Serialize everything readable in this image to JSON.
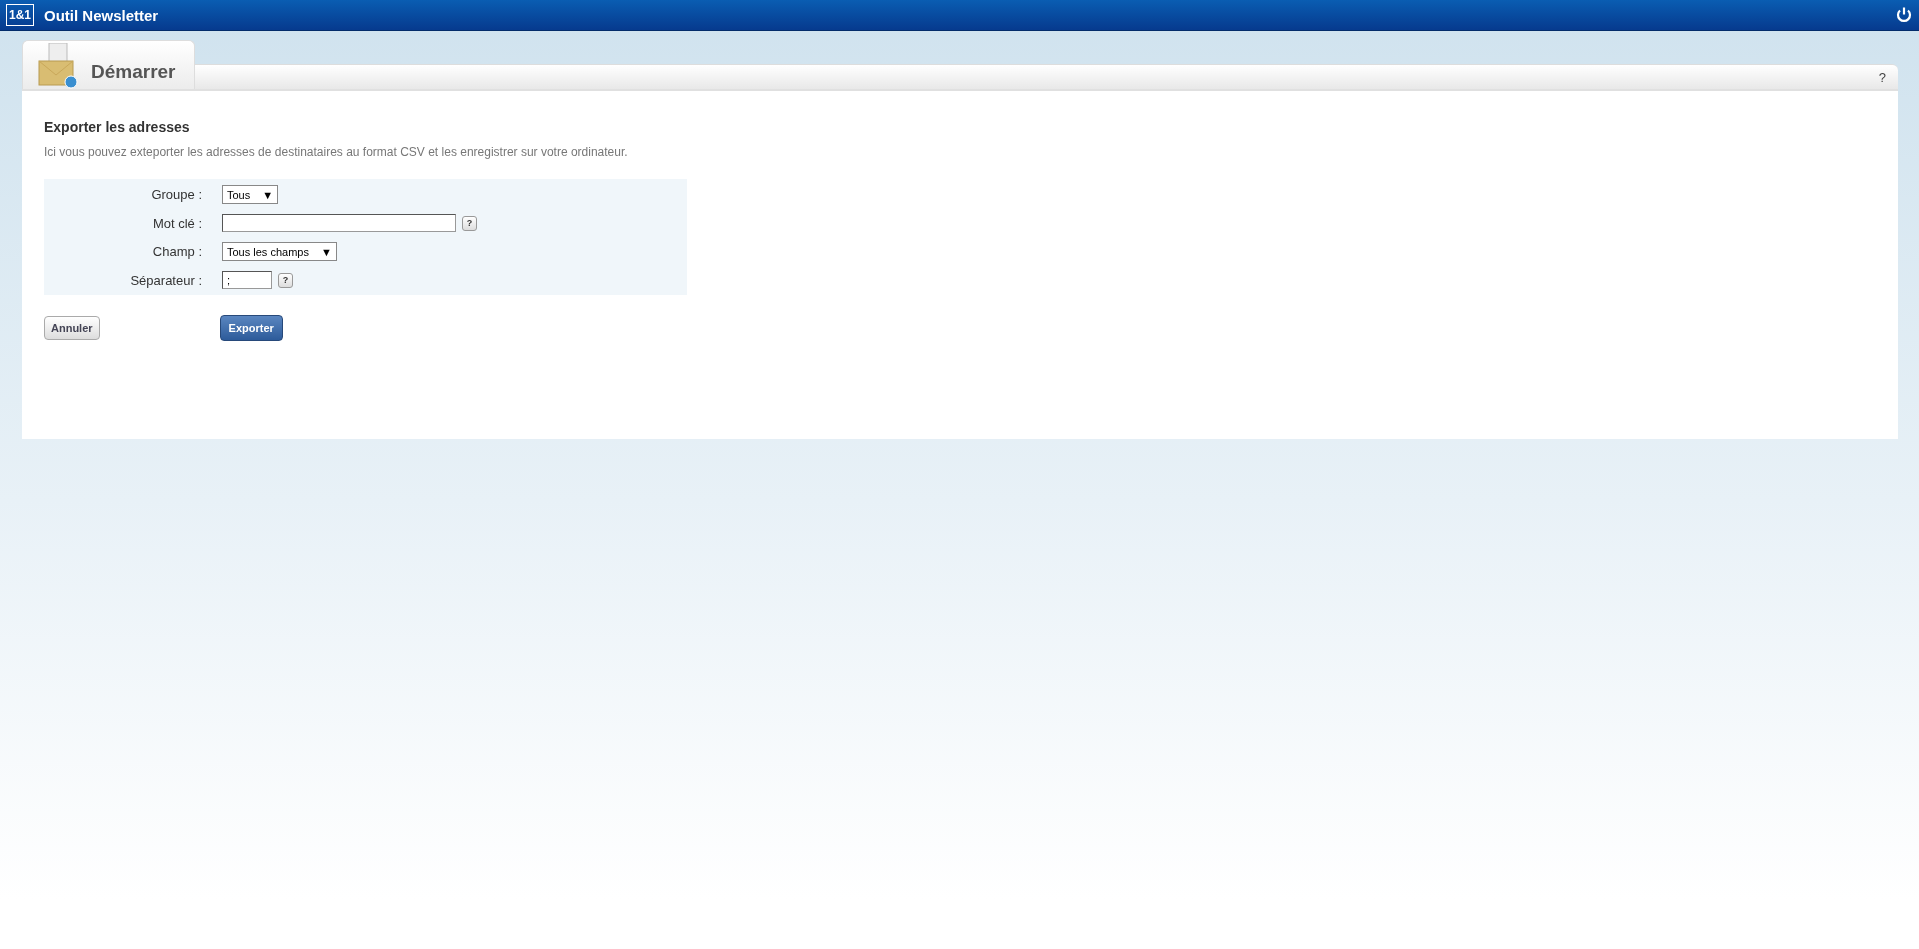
{
  "header": {
    "logo": "1&1",
    "title": "Outil Newsletter"
  },
  "tab": {
    "label": "Démarrer",
    "help": "?"
  },
  "section": {
    "title": "Exporter les adresses",
    "description": "Ici vous pouvez exteporter les adresses de destinataires au format CSV et les enregistrer sur votre ordinateur."
  },
  "form": [
    {
      "kind": "select",
      "label": "Groupe :",
      "value": "Tous",
      "arrow": "▼"
    },
    {
      "kind": "textfield",
      "label": "Mot clé :",
      "help": "?"
    },
    {
      "kind": "select",
      "label": "Champ :",
      "value": "Tous les champs",
      "arrow": "▼"
    },
    {
      "kind": "charfield",
      "label": "Séparateur :",
      "value": ";",
      "help": "?"
    }
  ],
  "buttons": [
    {
      "label": "Annuler",
      "kind": "secondary"
    },
    {
      "label": "Exporter",
      "kind": "primary"
    }
  ]
}
